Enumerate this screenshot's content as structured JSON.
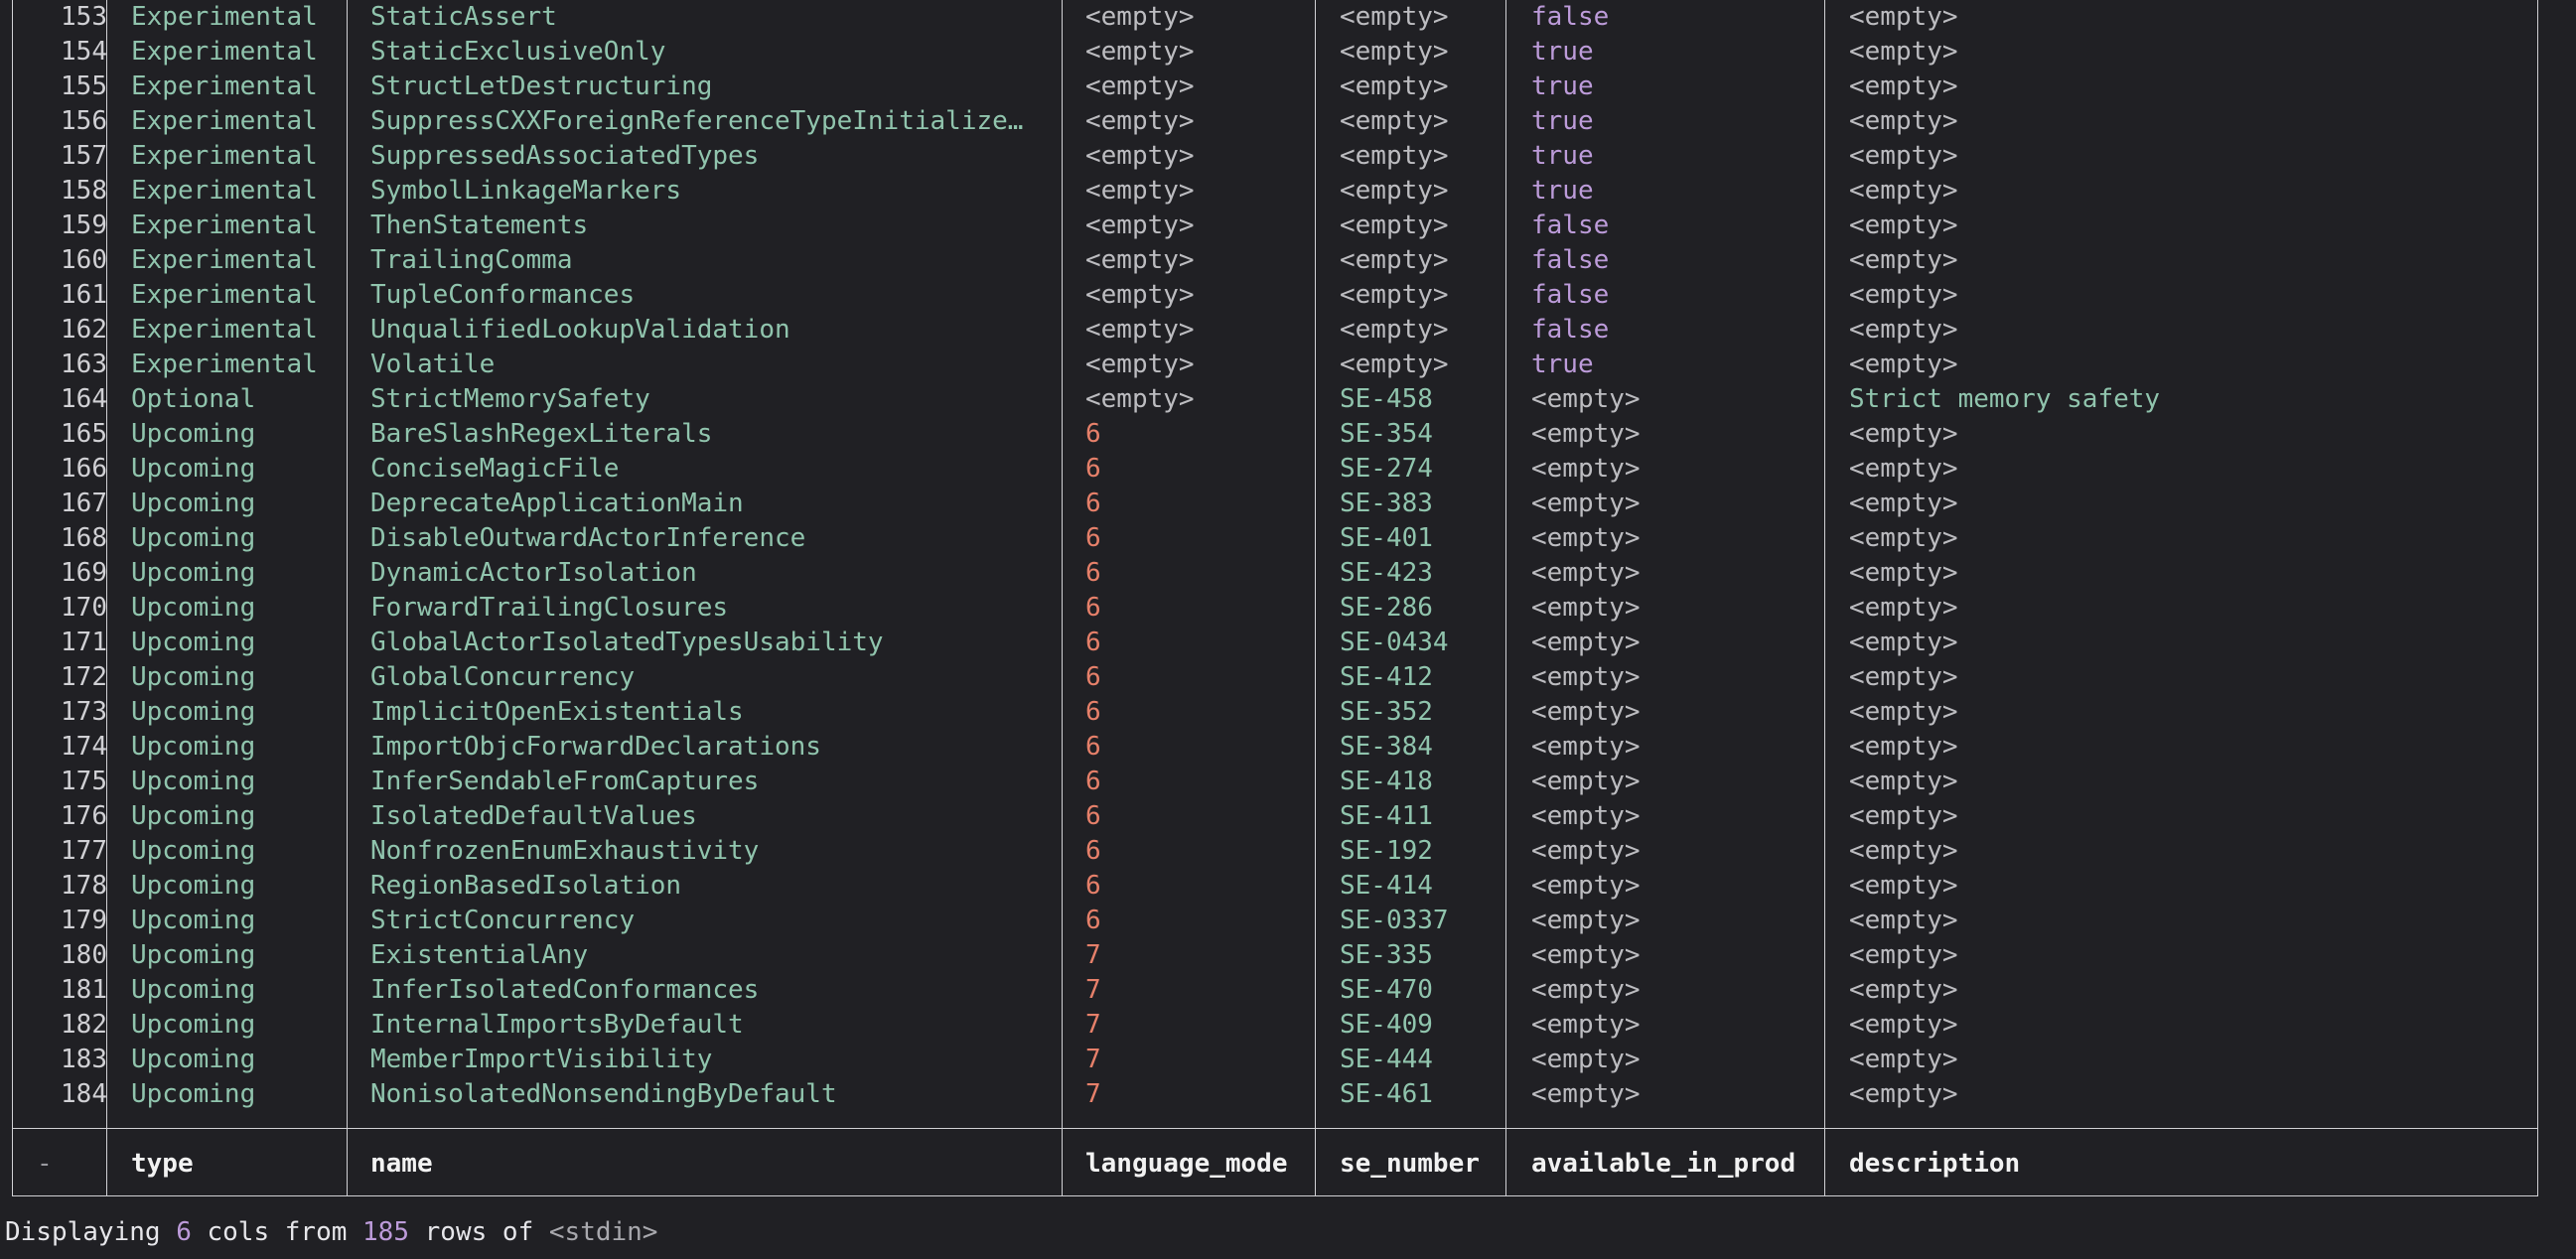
{
  "table": {
    "headers": {
      "index": "-",
      "type": "type",
      "name": "name",
      "language_mode": "language_mode",
      "se_number": "se_number",
      "available_in_prod": "available_in_prod",
      "description": "description"
    },
    "rows": [
      {
        "idx": "153",
        "type": "Experimental",
        "name": "StaticAssert",
        "lm": "<empty>",
        "se": "<empty>",
        "av": "false",
        "desc": "<empty>"
      },
      {
        "idx": "154",
        "type": "Experimental",
        "name": "StaticExclusiveOnly",
        "lm": "<empty>",
        "se": "<empty>",
        "av": "true",
        "desc": "<empty>"
      },
      {
        "idx": "155",
        "type": "Experimental",
        "name": "StructLetDestructuring",
        "lm": "<empty>",
        "se": "<empty>",
        "av": "true",
        "desc": "<empty>"
      },
      {
        "idx": "156",
        "type": "Experimental",
        "name": "SuppressCXXForeignReferenceTypeInitialize…",
        "lm": "<empty>",
        "se": "<empty>",
        "av": "true",
        "desc": "<empty>"
      },
      {
        "idx": "157",
        "type": "Experimental",
        "name": "SuppressedAssociatedTypes",
        "lm": "<empty>",
        "se": "<empty>",
        "av": "true",
        "desc": "<empty>"
      },
      {
        "idx": "158",
        "type": "Experimental",
        "name": "SymbolLinkageMarkers",
        "lm": "<empty>",
        "se": "<empty>",
        "av": "true",
        "desc": "<empty>"
      },
      {
        "idx": "159",
        "type": "Experimental",
        "name": "ThenStatements",
        "lm": "<empty>",
        "se": "<empty>",
        "av": "false",
        "desc": "<empty>"
      },
      {
        "idx": "160",
        "type": "Experimental",
        "name": "TrailingComma",
        "lm": "<empty>",
        "se": "<empty>",
        "av": "false",
        "desc": "<empty>"
      },
      {
        "idx": "161",
        "type": "Experimental",
        "name": "TupleConformances",
        "lm": "<empty>",
        "se": "<empty>",
        "av": "false",
        "desc": "<empty>"
      },
      {
        "idx": "162",
        "type": "Experimental",
        "name": "UnqualifiedLookupValidation",
        "lm": "<empty>",
        "se": "<empty>",
        "av": "false",
        "desc": "<empty>"
      },
      {
        "idx": "163",
        "type": "Experimental",
        "name": "Volatile",
        "lm": "<empty>",
        "se": "<empty>",
        "av": "true",
        "desc": "<empty>"
      },
      {
        "idx": "164",
        "type": "Optional",
        "name": "StrictMemorySafety",
        "lm": "<empty>",
        "se": "SE-458",
        "av": "<empty>",
        "desc": "Strict memory safety"
      },
      {
        "idx": "165",
        "type": "Upcoming",
        "name": "BareSlashRegexLiterals",
        "lm": "6",
        "se": "SE-354",
        "av": "<empty>",
        "desc": "<empty>"
      },
      {
        "idx": "166",
        "type": "Upcoming",
        "name": "ConciseMagicFile",
        "lm": "6",
        "se": "SE-274",
        "av": "<empty>",
        "desc": "<empty>"
      },
      {
        "idx": "167",
        "type": "Upcoming",
        "name": "DeprecateApplicationMain",
        "lm": "6",
        "se": "SE-383",
        "av": "<empty>",
        "desc": "<empty>"
      },
      {
        "idx": "168",
        "type": "Upcoming",
        "name": "DisableOutwardActorInference",
        "lm": "6",
        "se": "SE-401",
        "av": "<empty>",
        "desc": "<empty>"
      },
      {
        "idx": "169",
        "type": "Upcoming",
        "name": "DynamicActorIsolation",
        "lm": "6",
        "se": "SE-423",
        "av": "<empty>",
        "desc": "<empty>"
      },
      {
        "idx": "170",
        "type": "Upcoming",
        "name": "ForwardTrailingClosures",
        "lm": "6",
        "se": "SE-286",
        "av": "<empty>",
        "desc": "<empty>"
      },
      {
        "idx": "171",
        "type": "Upcoming",
        "name": "GlobalActorIsolatedTypesUsability",
        "lm": "6",
        "se": "SE-0434",
        "av": "<empty>",
        "desc": "<empty>"
      },
      {
        "idx": "172",
        "type": "Upcoming",
        "name": "GlobalConcurrency",
        "lm": "6",
        "se": "SE-412",
        "av": "<empty>",
        "desc": "<empty>"
      },
      {
        "idx": "173",
        "type": "Upcoming",
        "name": "ImplicitOpenExistentials",
        "lm": "6",
        "se": "SE-352",
        "av": "<empty>",
        "desc": "<empty>"
      },
      {
        "idx": "174",
        "type": "Upcoming",
        "name": "ImportObjcForwardDeclarations",
        "lm": "6",
        "se": "SE-384",
        "av": "<empty>",
        "desc": "<empty>"
      },
      {
        "idx": "175",
        "type": "Upcoming",
        "name": "InferSendableFromCaptures",
        "lm": "6",
        "se": "SE-418",
        "av": "<empty>",
        "desc": "<empty>"
      },
      {
        "idx": "176",
        "type": "Upcoming",
        "name": "IsolatedDefaultValues",
        "lm": "6",
        "se": "SE-411",
        "av": "<empty>",
        "desc": "<empty>"
      },
      {
        "idx": "177",
        "type": "Upcoming",
        "name": "NonfrozenEnumExhaustivity",
        "lm": "6",
        "se": "SE-192",
        "av": "<empty>",
        "desc": "<empty>"
      },
      {
        "idx": "178",
        "type": "Upcoming",
        "name": "RegionBasedIsolation",
        "lm": "6",
        "se": "SE-414",
        "av": "<empty>",
        "desc": "<empty>"
      },
      {
        "idx": "179",
        "type": "Upcoming",
        "name": "StrictConcurrency",
        "lm": "6",
        "se": "SE-0337",
        "av": "<empty>",
        "desc": "<empty>"
      },
      {
        "idx": "180",
        "type": "Upcoming",
        "name": "ExistentialAny",
        "lm": "7",
        "se": "SE-335",
        "av": "<empty>",
        "desc": "<empty>"
      },
      {
        "idx": "181",
        "type": "Upcoming",
        "name": "InferIsolatedConformances",
        "lm": "7",
        "se": "SE-470",
        "av": "<empty>",
        "desc": "<empty>"
      },
      {
        "idx": "182",
        "type": "Upcoming",
        "name": "InternalImportsByDefault",
        "lm": "7",
        "se": "SE-409",
        "av": "<empty>",
        "desc": "<empty>"
      },
      {
        "idx": "183",
        "type": "Upcoming",
        "name": "MemberImportVisibility",
        "lm": "7",
        "se": "SE-444",
        "av": "<empty>",
        "desc": "<empty>"
      },
      {
        "idx": "184",
        "type": "Upcoming",
        "name": "NonisolatedNonsendingByDefault",
        "lm": "7",
        "se": "SE-461",
        "av": "<empty>",
        "desc": "<empty>"
      }
    ]
  },
  "footer": {
    "prefix": "Displaying ",
    "cols": "6",
    "middle": " cols from ",
    "rows": "185",
    "suffix": " rows of ",
    "source": "<stdin>"
  },
  "colors": {
    "background": "#202024",
    "teal_text": "#90c4ad",
    "bool_purple": "#bc9bd9",
    "number_orange": "#e6806a"
  }
}
